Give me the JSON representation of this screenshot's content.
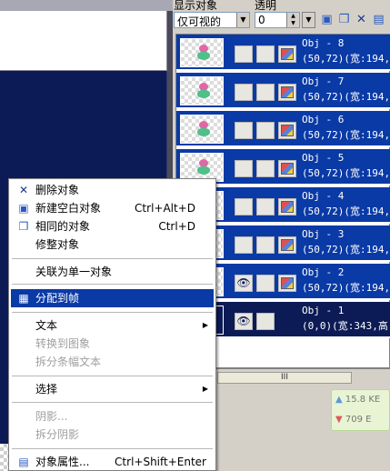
{
  "panel": {
    "label_display": "显示对象",
    "label_opacity": "透明",
    "display_filter": "仅可视的",
    "opacity_value": "0",
    "toolbar_icons": [
      "new-object-icon",
      "duplicate-icon",
      "delete-icon",
      "properties-icon"
    ]
  },
  "objects": [
    {
      "name": "Obj - 8",
      "meta": "(50,72)(宽:194,高",
      "eye": false
    },
    {
      "name": "Obj - 7",
      "meta": "(50,72)(宽:194,高",
      "eye": false
    },
    {
      "name": "Obj - 6",
      "meta": "(50,72)(宽:194,高",
      "eye": false
    },
    {
      "name": "Obj - 5",
      "meta": "(50,72)(宽:194,高",
      "eye": false
    },
    {
      "name": "Obj - 4",
      "meta": "(50,72)(宽:194,高",
      "eye": false
    },
    {
      "name": "Obj - 3",
      "meta": "(50,72)(宽:194,高",
      "eye": false
    },
    {
      "name": "Obj - 2",
      "meta": "(50,72)(宽:194,高",
      "eye": true
    },
    {
      "name": "Obj - 1",
      "meta": "(0,0)(宽:343,高:",
      "eye": true
    }
  ],
  "scrollbar": {
    "thumb_grip": "III"
  },
  "speed": {
    "up": "15.8 KE",
    "down": "709 E"
  },
  "menu": {
    "items": {
      "delete": {
        "label": "删除对象"
      },
      "new_blank": {
        "label": "新建空白对象",
        "shortcut": "Ctrl+Alt+D"
      },
      "same": {
        "label": "相同的对象",
        "shortcut": "Ctrl+D"
      },
      "trim": {
        "label": "修整对象"
      },
      "link_single": {
        "label": "关联为单一对象"
      },
      "assign_frame": {
        "label": "分配到帧"
      },
      "text": {
        "label": "文本"
      },
      "to_image": {
        "label": "转换到图象"
      },
      "split_text": {
        "label": "拆分条幅文本"
      },
      "select": {
        "label": "选择"
      },
      "shadow": {
        "label": "阴影..."
      },
      "split_shadow": {
        "label": "拆分阴影"
      },
      "properties": {
        "label": "对象属性...",
        "shortcut": "Ctrl+Shift+Enter"
      }
    }
  }
}
